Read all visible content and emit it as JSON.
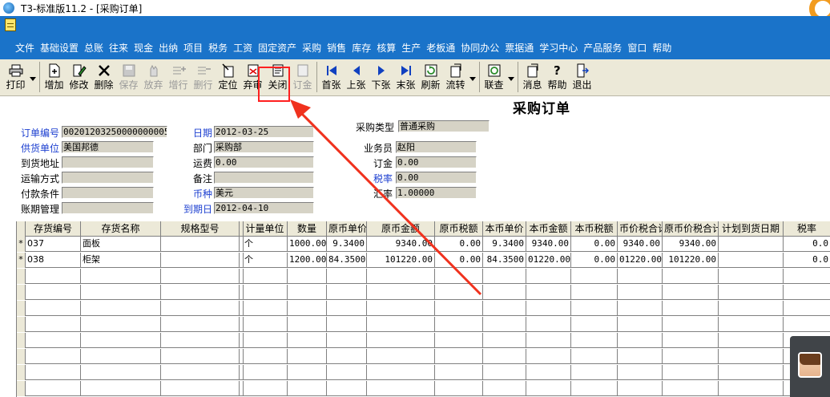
{
  "window": {
    "title": "T3-标准版11.2 - [采购订单]"
  },
  "menu": [
    "文件",
    "基础设置",
    "总账",
    "往来",
    "现金",
    "出纳",
    "项目",
    "税务",
    "工资",
    "固定资产",
    "采购",
    "销售",
    "库存",
    "核算",
    "生产",
    "老板通",
    "协同办公",
    "票据通",
    "学习中心",
    "产品服务",
    "窗口",
    "帮助"
  ],
  "toolbar": {
    "print": "打印",
    "add": "增加",
    "edit": "修改",
    "delete": "删除",
    "save": "保存",
    "discard": "放弃",
    "add_row": "增行",
    "delete_row": "删行",
    "locate": "定位",
    "abandon_review": "弃审",
    "close": "关闭",
    "deposit": "订金",
    "first": "首张",
    "prev": "上张",
    "next": "下张",
    "last": "末张",
    "refresh": "刷新",
    "flow": "流转",
    "query": "联查",
    "message": "消息",
    "help": "帮助",
    "exit": "退出"
  },
  "form": {
    "title": "采购订单",
    "order_no_label": "订单编号",
    "order_no": "00201203250000000005",
    "date_label": "日期",
    "date": "2012-03-25",
    "purchase_type_label": "采购类型",
    "purchase_type": "普通采购",
    "supplier_label": "供货单位",
    "supplier": "美国邦德",
    "dept_label": "部门",
    "dept": "采购部",
    "salesman_label": "业务员",
    "salesman": "赵阳",
    "address_label": "到货地址",
    "address": "",
    "freight_label": "运费",
    "freight": "0.00",
    "deposit_label": "订金",
    "deposit": "0.00",
    "transport_label": "运输方式",
    "transport": "",
    "remark_label": "备注",
    "remark": "",
    "tax_rate_label": "税率",
    "tax_rate": "0.00",
    "payment_label": "付款条件",
    "payment": "",
    "currency_label": "币种",
    "currency": "美元",
    "exchange_label": "汇率",
    "exchange": "1.00000",
    "period_label": "账期管理",
    "period": "",
    "due_label": "到期日",
    "due": "2012-04-10"
  },
  "grid": {
    "headers": [
      "存货编号",
      "存货名称",
      "规格型号",
      "",
      "计量单位",
      "数量",
      "原币单价",
      "原币金额",
      "原币税额",
      "本币单价",
      "本币金额",
      "本币税额",
      "币价税合计",
      "原币价税合计",
      "计划到货日期",
      "税率"
    ],
    "rows": [
      {
        "marker": "*",
        "cells": [
          "037",
          "面板",
          "",
          "",
          "个",
          "1000.00",
          "9.3400",
          "9340.00",
          "0.00",
          "9.3400",
          "9340.00",
          "0.00",
          "9340.00",
          "9340.00",
          "",
          "0.0"
        ]
      },
      {
        "marker": "*",
        "cells": [
          "038",
          "柜架",
          "",
          "",
          "个",
          "1200.00",
          "84.3500",
          "101220.00",
          "0.00",
          "84.3500",
          "01220.00",
          "0.00",
          "01220.00",
          "101220.00",
          "",
          "0.0"
        ]
      }
    ]
  },
  "colors": {
    "menu_bg": "#1a73c9",
    "toolbar_bg": "#ece9d8",
    "highlight": "#ff2020",
    "label_blue": "#1c3fd0"
  }
}
